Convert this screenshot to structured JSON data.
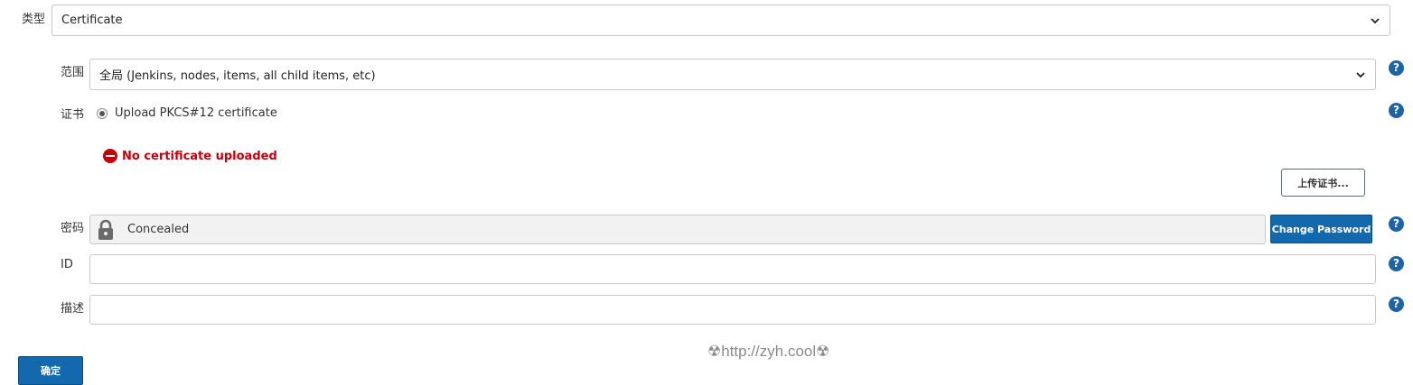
{
  "type_field": {
    "label": "类型",
    "value": "Certificate"
  },
  "scope_field": {
    "label": "范围",
    "value": "全局 (Jenkins, nodes, items, all child items, etc)"
  },
  "certificate_field": {
    "label": "证书",
    "option_label": "Upload PKCS#12 certificate",
    "error_text": "No certificate uploaded",
    "upload_button": "上传证书..."
  },
  "password_field": {
    "label": "密码",
    "value": "Concealed",
    "change_button": "Change Password"
  },
  "id_field": {
    "label": "ID",
    "value": ""
  },
  "description_field": {
    "label": "描述",
    "value": ""
  },
  "help_icon_text": "?",
  "watermark": "☢http://zyh.cool☢",
  "submit_button": "确定",
  "colors": {
    "primary": "#1369ab",
    "help": "#1c64a6",
    "error": "#c4000a"
  },
  "icons": [
    "chevron-down-icon",
    "help-icon",
    "error-icon",
    "lock-icon",
    "radio-icon"
  ]
}
